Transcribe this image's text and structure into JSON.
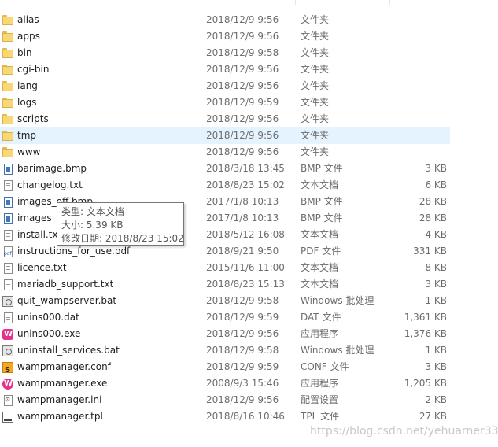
{
  "files": [
    {
      "name": "alias",
      "date": "2018/12/9 9:56",
      "type": "文件夹",
      "size": "",
      "icon": "folder-icon"
    },
    {
      "name": "apps",
      "date": "2018/12/9 9:56",
      "type": "文件夹",
      "size": "",
      "icon": "folder-icon"
    },
    {
      "name": "bin",
      "date": "2018/12/9 9:58",
      "type": "文件夹",
      "size": "",
      "icon": "folder-icon"
    },
    {
      "name": "cgi-bin",
      "date": "2018/12/9 9:56",
      "type": "文件夹",
      "size": "",
      "icon": "folder-icon"
    },
    {
      "name": "lang",
      "date": "2018/12/9 9:56",
      "type": "文件夹",
      "size": "",
      "icon": "folder-icon"
    },
    {
      "name": "logs",
      "date": "2018/12/9 9:59",
      "type": "文件夹",
      "size": "",
      "icon": "folder-icon"
    },
    {
      "name": "scripts",
      "date": "2018/12/9 9:56",
      "type": "文件夹",
      "size": "",
      "icon": "folder-icon"
    },
    {
      "name": "tmp",
      "date": "2018/12/9 9:56",
      "type": "文件夹",
      "size": "",
      "icon": "folder-icon",
      "selected": true
    },
    {
      "name": "www",
      "date": "2018/12/9 9:56",
      "type": "文件夹",
      "size": "",
      "icon": "folder-icon"
    },
    {
      "name": "barimage.bmp",
      "date": "2018/3/18 13:45",
      "type": "BMP 文件",
      "size": "3 KB",
      "icon": "bmp-file-icon"
    },
    {
      "name": "changelog.txt",
      "date": "2018/8/23 15:02",
      "type": "文本文档",
      "size": "6 KB",
      "icon": "text-file-icon"
    },
    {
      "name": "images_off.bmp",
      "date": "2017/1/8 10:13",
      "type": "BMP 文件",
      "size": "28 KB",
      "icon": "bmp-file-icon"
    },
    {
      "name": "images_on.bmp",
      "date": "2017/1/8 10:13",
      "type": "BMP 文件",
      "size": "28 KB",
      "icon": "bmp-file-icon"
    },
    {
      "name": "install.txt",
      "date": "2018/5/12 16:08",
      "type": "文本文档",
      "size": "4 KB",
      "icon": "text-file-icon"
    },
    {
      "name": "instructions_for_use.pdf",
      "date": "2018/9/21 9:50",
      "type": "PDF 文件",
      "size": "331 KB",
      "icon": "pdf-file-icon"
    },
    {
      "name": "licence.txt",
      "date": "2015/11/6 11:00",
      "type": "文本文档",
      "size": "8 KB",
      "icon": "text-file-icon"
    },
    {
      "name": "mariadb_support.txt",
      "date": "2018/8/23 15:13",
      "type": "文本文档",
      "size": "3 KB",
      "icon": "text-file-icon"
    },
    {
      "name": "quit_wampserver.bat",
      "date": "2018/12/9 9:58",
      "type": "Windows 批处理",
      "size": "1 KB",
      "icon": "batch-file-icon"
    },
    {
      "name": "unins000.dat",
      "date": "2018/12/9 9:59",
      "type": "DAT 文件",
      "size": "1,361 KB",
      "icon": "text-file-icon"
    },
    {
      "name": "unins000.exe",
      "date": "2018/12/9 9:56",
      "type": "应用程序",
      "size": "1,376 KB",
      "icon": "wamp-app-icon"
    },
    {
      "name": "uninstall_services.bat",
      "date": "2018/12/9 9:58",
      "type": "Windows 批处理",
      "size": "1 KB",
      "icon": "batch-file-icon"
    },
    {
      "name": "wampmanager.conf",
      "date": "2018/12/9 9:59",
      "type": "CONF 文件",
      "size": "3 KB",
      "icon": "conf-file-icon"
    },
    {
      "name": "wampmanager.exe",
      "date": "2008/9/3 15:46",
      "type": "应用程序",
      "size": "1,205 KB",
      "icon": "wamp-exe-icon"
    },
    {
      "name": "wampmanager.ini",
      "date": "2018/12/9 9:56",
      "type": "配置设置",
      "size": "2 KB",
      "icon": "ini-file-icon"
    },
    {
      "name": "wampmanager.tpl",
      "date": "2018/8/16 10:46",
      "type": "TPL 文件",
      "size": "27 KB",
      "icon": "tpl-file-icon"
    }
  ],
  "tooltip": {
    "type_line": "类型: 文本文档",
    "size_line": "大小: 5.39 KB",
    "modified_line": "修改日期: 2018/8/23 15:02"
  },
  "watermark": "https://blog.csdn.net/yehuarner33"
}
